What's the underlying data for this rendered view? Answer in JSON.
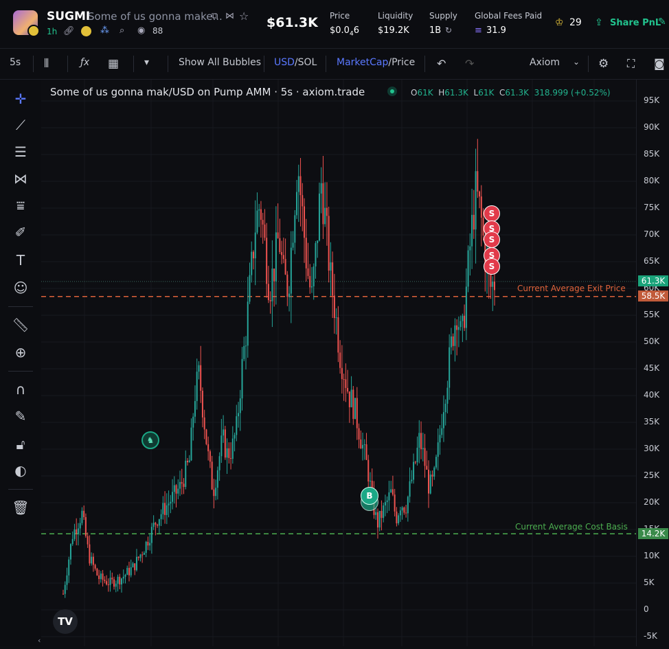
{
  "header": {
    "token_symbol": "SUGMI",
    "token_name": "Some of us gonna make...",
    "timeframe": "1h",
    "holders_count": "88",
    "market_cap": "$61.3K",
    "price_label": "Price",
    "price_value": "$0.0",
    "price_sub": "4",
    "price_tail": "6",
    "liquidity_label": "Liquidity",
    "liquidity_value": "$19.2K",
    "supply_label": "Supply",
    "supply_value": "1B",
    "fees_label": "Global Fees Paid",
    "fees_value": "31.9",
    "crown_count": "29",
    "share_label": "Share PnL"
  },
  "toolbar": {
    "interval": "5s",
    "bubbles": "Show All Bubbles",
    "usd": "USD",
    "sol": "/SOL",
    "marketcap": "MarketCap",
    "price": "/Price",
    "axiom": "Axiom"
  },
  "legend": {
    "title": "Some of us gonna mak/USD on Pump AMM · 5s · axiom.trade",
    "o_key": "O",
    "o": "61K",
    "h_key": "H",
    "h": "61.3K",
    "l_key": "L",
    "l": "61K",
    "c_key": "C",
    "c": "61.3K",
    "change": "318.999 (+0.52%)"
  },
  "lines": {
    "exit_label": "Current Average Exit Price",
    "exit_value": "58.5K",
    "cost_label": "Current Average Cost Basis",
    "cost_value": "14.2K",
    "last_value": "61.3K"
  },
  "markers": {
    "sell": "S",
    "buy": "B"
  },
  "tv_logo": "TV",
  "colors": {
    "up": "#26a69a",
    "down": "#ef5350",
    "exit": "#e0633a",
    "cost": "#4caf50",
    "accent": "#22c38e"
  },
  "chart_data": {
    "type": "candlestick",
    "y_axis_ticks": [
      "95K",
      "90K",
      "85K",
      "80K",
      "75K",
      "70K",
      "65K",
      "60K",
      "55K",
      "50K",
      "45K",
      "40K",
      "35K",
      "30K",
      "25K",
      "20K",
      "15K",
      "10K",
      "5K",
      "0",
      "-5K"
    ],
    "ylim": [
      -5000,
      95000
    ],
    "close_path": [
      [
        0,
        3
      ],
      [
        4,
        14
      ],
      [
        8,
        18
      ],
      [
        11,
        10
      ],
      [
        15,
        6
      ],
      [
        20,
        5
      ],
      [
        25,
        6
      ],
      [
        30,
        8
      ],
      [
        35,
        12
      ],
      [
        40,
        17
      ],
      [
        45,
        20
      ],
      [
        50,
        23
      ],
      [
        54,
        28
      ],
      [
        56,
        40
      ],
      [
        58,
        44
      ],
      [
        60,
        36
      ],
      [
        62,
        28
      ],
      [
        64,
        22
      ],
      [
        66,
        27
      ],
      [
        68,
        32
      ],
      [
        70,
        29
      ],
      [
        72,
        30
      ],
      [
        74,
        34
      ],
      [
        76,
        44
      ],
      [
        78,
        52
      ],
      [
        80,
        62
      ],
      [
        82,
        72
      ],
      [
        84,
        76
      ],
      [
        86,
        68
      ],
      [
        88,
        60
      ],
      [
        90,
        64
      ],
      [
        92,
        70
      ],
      [
        94,
        62
      ],
      [
        96,
        60
      ],
      [
        98,
        72
      ],
      [
        100,
        84
      ],
      [
        102,
        74
      ],
      [
        104,
        64
      ],
      [
        106,
        58
      ],
      [
        108,
        68
      ],
      [
        110,
        80
      ],
      [
        112,
        72
      ],
      [
        114,
        62
      ],
      [
        116,
        56
      ],
      [
        118,
        48
      ],
      [
        120,
        44
      ],
      [
        122,
        40
      ],
      [
        124,
        38
      ],
      [
        126,
        34
      ],
      [
        128,
        30
      ],
      [
        130,
        26
      ],
      [
        132,
        20
      ],
      [
        134,
        16
      ],
      [
        136,
        18
      ],
      [
        138,
        20
      ],
      [
        140,
        22
      ],
      [
        142,
        17
      ],
      [
        144,
        20
      ],
      [
        146,
        19
      ],
      [
        148,
        23
      ],
      [
        150,
        27
      ],
      [
        152,
        32
      ],
      [
        154,
        28
      ],
      [
        156,
        23
      ],
      [
        158,
        24
      ],
      [
        160,
        30
      ],
      [
        162,
        38
      ],
      [
        164,
        44
      ],
      [
        166,
        51
      ],
      [
        168,
        56
      ],
      [
        170,
        50
      ],
      [
        172,
        60
      ],
      [
        174,
        70
      ],
      [
        176,
        78
      ],
      [
        178,
        74
      ],
      [
        180,
        66
      ],
      [
        182,
        60
      ],
      [
        184,
        61.3
      ]
    ],
    "sell_markers": 5,
    "buy_markers": 1,
    "horizontal_lines": [
      {
        "label": "Current Average Exit Price",
        "value": 58500
      },
      {
        "label": "Current Average Cost Basis",
        "value": 14200
      }
    ]
  }
}
